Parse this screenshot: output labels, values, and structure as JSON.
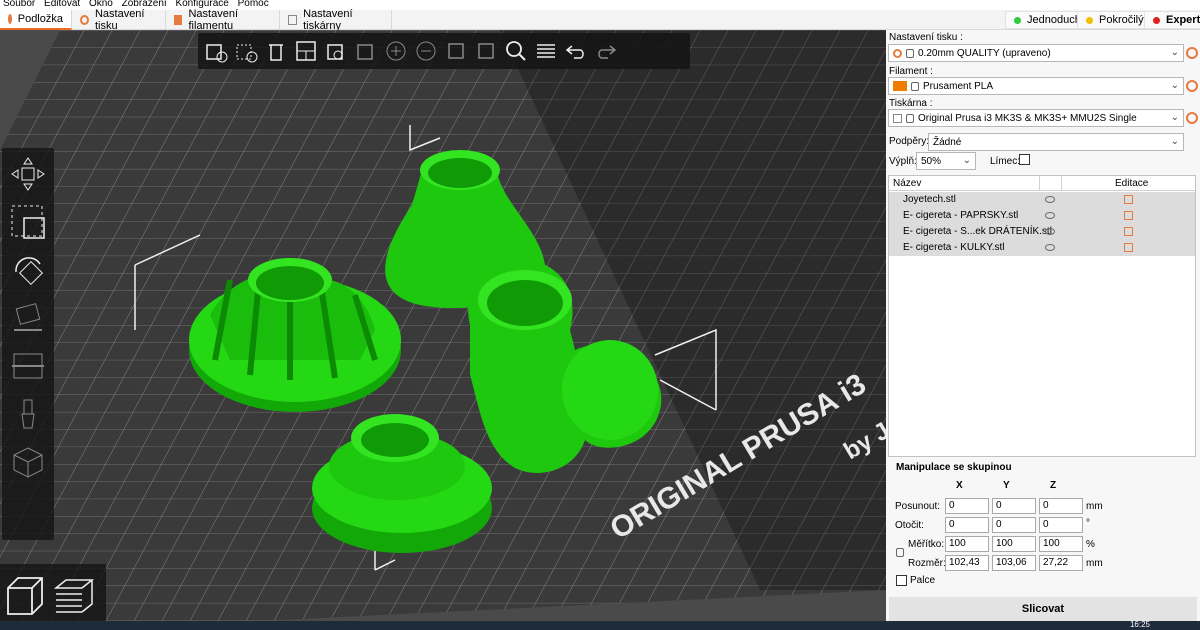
{
  "menu": [
    "Soubor",
    "Editovat",
    "Okno",
    "Zobrazení",
    "Konfigurace",
    "Pomoc"
  ],
  "tabs": [
    {
      "label": "Podložka",
      "icon": "plater-icon",
      "active": true
    },
    {
      "label": "Nastavení tisku",
      "icon": "print-settings-icon",
      "active": false
    },
    {
      "label": "Nastavení filamentu",
      "icon": "filament-icon",
      "active": false
    },
    {
      "label": "Nastavení tiskárny",
      "icon": "printer-icon",
      "active": false
    }
  ],
  "modes": [
    {
      "label": "Jednoduchý",
      "color": "#2ecc40"
    },
    {
      "label": "Pokročilý",
      "color": "#f0c000"
    },
    {
      "label": "Expert",
      "color": "#e02020",
      "bold": true
    }
  ],
  "bed": {
    "brand": "ORIGINAL PRUSA i3",
    "sub": "by J"
  },
  "toolbar_icons": [
    "add-icon",
    "delete-icon",
    "delete-all-icon",
    "arrange-icon",
    "copy-icon",
    "paste-icon",
    "add-instance-icon",
    "remove-instance-icon",
    "split-objects-icon",
    "split-parts-icon",
    "search-icon",
    "layers-editing-icon",
    "undo-icon",
    "redo-icon"
  ],
  "sidebar": {
    "print_settings_label": "Nastavení tisku :",
    "print_settings_value": "0.20mm QUALITY (upraveno)",
    "filament_label": "Filament :",
    "filament_value": "Prusament PLA",
    "filament_color": "#f07c00",
    "printer_label": "Tiskárna :",
    "printer_value": "Original Prusa i3 MK3S & MK3S+ MMU2S Single",
    "supports_label": "Podpěry:",
    "supports_value": "Žádné",
    "infill_label": "Výplň:",
    "infill_value": "50%",
    "brim_label": "Límec:",
    "objects_header_name": "Název",
    "objects_header_edit": "Editace",
    "objects": [
      {
        "name": "Joyetech.stl"
      },
      {
        "name": "E- cigereta - PAPRSKY.stl"
      },
      {
        "name": "E- cigereta - S...ek DRÁTENÍK.stl"
      },
      {
        "name": "E- cigereta - KULKY.stl"
      }
    ],
    "manip_title": "Manipulace se skupinou",
    "axes": [
      "X",
      "Y",
      "Z"
    ],
    "position_label": "Posunout:",
    "rotation_label": "Otočit:",
    "scale_label": "Měřítko:",
    "size_label": "Rozměr:",
    "position": [
      "0",
      "0",
      "0"
    ],
    "rotation": [
      "0",
      "0",
      "0"
    ],
    "scale": [
      "100",
      "100",
      "100"
    ],
    "size": [
      "102,43",
      "103,06",
      "27,22"
    ],
    "unit_mm": "mm",
    "unit_deg": "°",
    "unit_pct": "%",
    "inches_label": "Palce",
    "slice_label": "Slicovat"
  },
  "clock": "16:25",
  "colors": {
    "accent": "#ed6b21",
    "model": "#22dd11",
    "bed": "#2e2e2e"
  }
}
